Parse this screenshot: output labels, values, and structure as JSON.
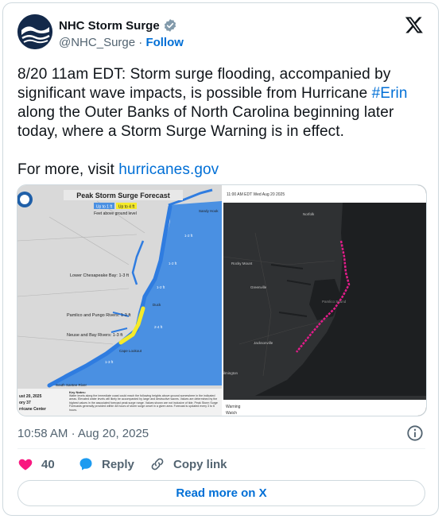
{
  "account": {
    "display_name": "NHC Storm Surge",
    "handle": "@NHC_Surge",
    "separator": "·",
    "follow_label": "Follow"
  },
  "tweet": {
    "line_text": "8/20 11am EDT: Storm surge flooding, accompanied by significant wave impacts, is possible from Hurricane ",
    "hashtag": "#Erin",
    "line_text_2": " along the Outer Banks of North Carolina beginning later today, where a Storm Surge Warning is in effect.",
    "more_prefix": "For more, visit ",
    "more_link": "hurricanes.gov"
  },
  "media": {
    "left": {
      "title": "Peak Storm Surge Forecast",
      "legend_a": "Up to 1 ft",
      "legend_b": "Up to 4 ft",
      "legend_caption": "Feet above ground level",
      "label_sandy_hook": "Sandy Hook",
      "label_chesapeake": "Lower Chesapeake Bay: 1-3 ft",
      "label_pamlico": "Pamlico and Pungo Rivers: 1-3 ft",
      "label_neuse": "Neuse and Bay Rivers: 1-3 ft",
      "label_duck": "Duck",
      "label_cape_lookout": "Cape Lookout",
      "label_south_santee": "South Santee River",
      "label_1_2_a": "1-2 ft",
      "label_1_2_b": "1-2 ft",
      "label_1_2_c": "1-2 ft",
      "label_2_4": "2-4 ft",
      "label_1_3": "1-3 ft",
      "footer_date": "ust 20, 2025",
      "footer_adv": "ory 37",
      "footer_center": "rricane Center",
      "notes_heading": "Key Notes:",
      "notes_text": "Water levels along the immediate coast could reach the following heights above ground somewhere in the indicated areas. Elevated water levels will likely be accompanied by large and destructive waves. Values are determined by the highest values in the associated forecast peak surge range. Values shown are not inclusive of tide. Peak Storm Surge Forecasts generally provided within 48 hours of storm surge onset in a given area. Forecast is updated every 3 to 6 hours."
    },
    "right": {
      "header": "11:00 AM EDT Wed Aug 20 2025",
      "label_norfolk": "Norfolk",
      "label_rocky_mount": "Rocky Mount",
      "label_greenville": "Greenville",
      "label_pamlico_sound": "Pamlico Sound",
      "label_jacksonville": "Jacksonville",
      "label_wilmington": "ilmington",
      "legend_warning": "Warning",
      "legend_watch": "Watch"
    }
  },
  "meta": {
    "time": "10:58 AM",
    "separator": "·",
    "date": "Aug 20, 2025"
  },
  "actions": {
    "likes_count": "40",
    "reply_label": "Reply",
    "copy_label": "Copy link"
  },
  "read_more_label": "Read more on X",
  "colors": {
    "accent_blue": "#006fd6",
    "like_red": "#f91880",
    "reply_blue": "#1d9bf0",
    "muted": "#536471",
    "surge_blue": "#3d8be0",
    "surge_yellow": "#f5ea2a",
    "warning_magenta": "#e21c8a"
  }
}
